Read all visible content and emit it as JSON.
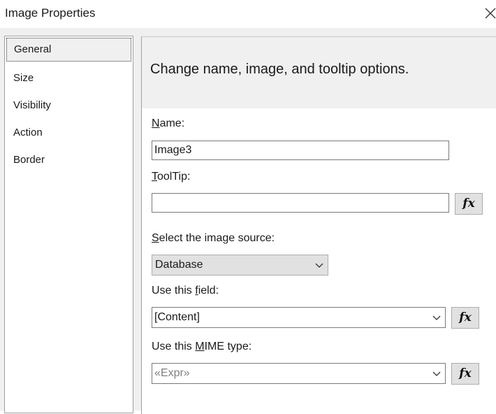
{
  "window": {
    "title": "Image Properties",
    "close_glyph": "✕"
  },
  "sidebar": {
    "items": [
      {
        "label": "General",
        "selected": true
      },
      {
        "label": "Size"
      },
      {
        "label": "Visibility"
      },
      {
        "label": "Action"
      },
      {
        "label": "Border"
      }
    ]
  },
  "panel": {
    "header": "Change name, image, and tooltip options.",
    "name": {
      "label_accel": "N",
      "label_rest": "ame:",
      "value": "Image3"
    },
    "tooltip": {
      "label_accel": "T",
      "label_rest": "oolTip:",
      "value": "",
      "fx": "fx"
    },
    "image_source": {
      "label_accel": "S",
      "label_rest": "elect the image source:",
      "value": "Database"
    },
    "field": {
      "label_pre": "Use this ",
      "label_accel": "f",
      "label_rest": "ield:",
      "value": "[Content]",
      "fx": "fx"
    },
    "mime": {
      "label_pre": "Use this ",
      "label_accel": "M",
      "label_rest": "IME type:",
      "value": "«Expr»",
      "fx": "fx"
    }
  }
}
